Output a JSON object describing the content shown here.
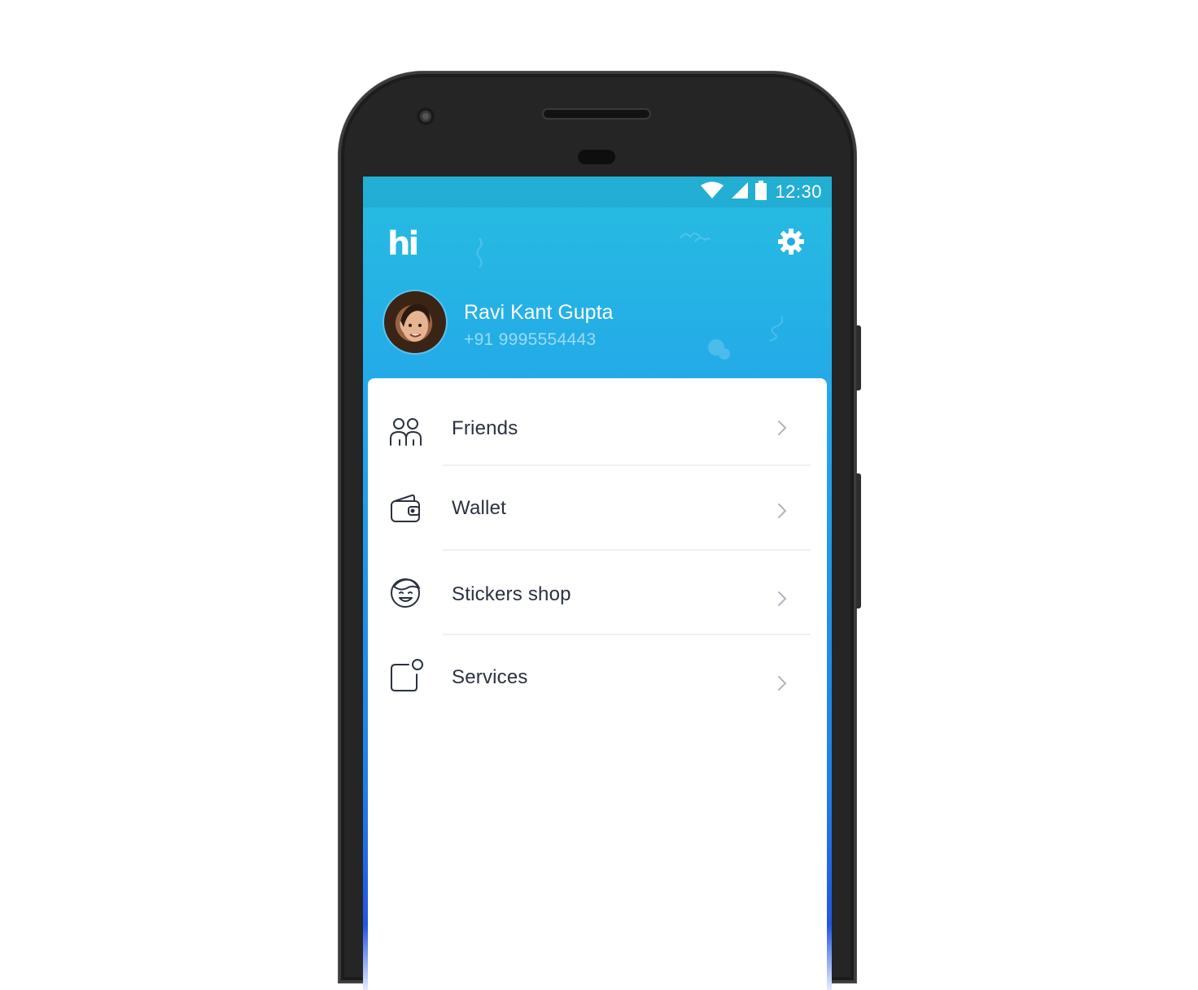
{
  "status_bar": {
    "time": "12:30",
    "icons": [
      "wifi-icon",
      "signal-icon",
      "battery-icon"
    ]
  },
  "header": {
    "logo_text": "hi",
    "settings_icon": "gear-icon"
  },
  "profile": {
    "name": "Ravi Kant Gupta",
    "phone": "+91 9995554443"
  },
  "menu": {
    "items": [
      {
        "label": "Friends",
        "icon": "friends-icon"
      },
      {
        "label": "Wallet",
        "icon": "wallet-icon"
      },
      {
        "label": "Stickers shop",
        "icon": "sticker-icon"
      },
      {
        "label": "Services",
        "icon": "services-icon"
      }
    ]
  },
  "colors": {
    "header_gradient_top": "#27bde0",
    "header_gradient_bottom": "#1f7fe8",
    "text_dark": "#2a3140",
    "chevron": "#b0b5bd"
  }
}
